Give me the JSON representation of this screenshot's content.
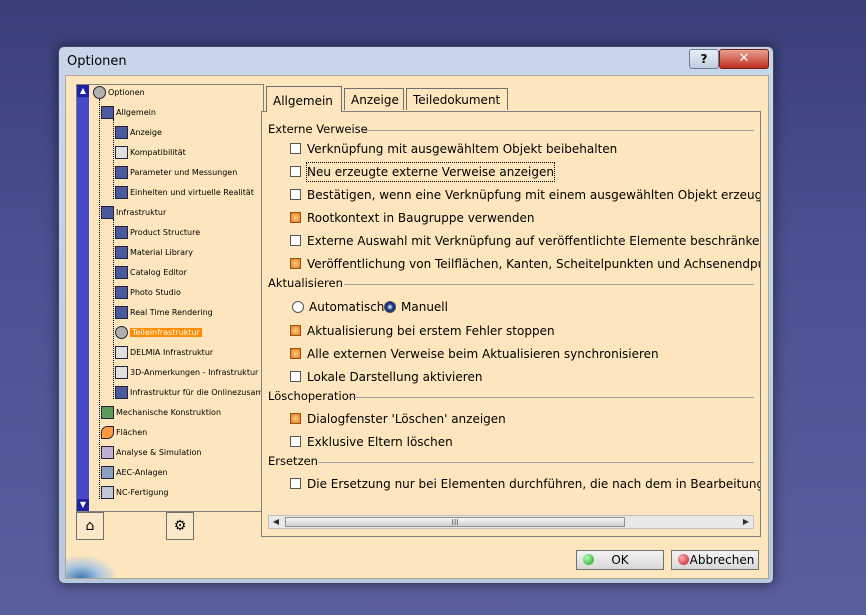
{
  "window": {
    "title": "Optionen",
    "help_label": "?",
    "close_label": "✕"
  },
  "tree": {
    "items": [
      {
        "label": "Optionen"
      },
      {
        "label": "Allgemein"
      },
      {
        "label": "Anzeige"
      },
      {
        "label": "Kompatibilität"
      },
      {
        "label": "Parameter und Messungen"
      },
      {
        "label": "Einheiten und virtuelle Realität"
      },
      {
        "label": "Infrastruktur"
      },
      {
        "label": "Product Structure"
      },
      {
        "label": "Material Library"
      },
      {
        "label": "Catalog Editor"
      },
      {
        "label": "Photo Studio"
      },
      {
        "label": "Real Time Rendering"
      },
      {
        "label": "Teileinfrastruktur"
      },
      {
        "label": "DELMIA Infrastruktur"
      },
      {
        "label": "3D-Anmerkungen - Infrastruktur"
      },
      {
        "label": "Infrastruktur für die Onlinezusamme"
      },
      {
        "label": "Mechanische Konstruktion"
      },
      {
        "label": "Flächen"
      },
      {
        "label": "Analyse & Simulation"
      },
      {
        "label": "AEC-Anlagen"
      },
      {
        "label": "NC-Fertigung"
      }
    ]
  },
  "tabs": [
    {
      "label": "Allgemein"
    },
    {
      "label": "Anzeige"
    },
    {
      "label": "Teiledokument"
    }
  ],
  "groups": {
    "externe": {
      "title": "Externe Verweise",
      "options": [
        {
          "label": "Verknüpfung mit ausgewähltem Objekt beibehalten",
          "checked": false
        },
        {
          "label": "Neu erzeugte externe Verweise anzeigen",
          "checked": false
        },
        {
          "label": "Bestätigen, wenn eine Verknüpfung mit einem ausgewählten Objekt erzeugt wird",
          "checked": false
        },
        {
          "label": "Rootkontext in Baugruppe verwenden",
          "checked": true
        },
        {
          "label": "Externe Auswahl mit Verknüpfung auf veröffentlichte Elemente beschränken",
          "checked": false
        },
        {
          "label": "Veröffentlichung von Teilflächen, Kanten, Scheitelpunkten und Achsenendpunkten z",
          "checked": true
        }
      ]
    },
    "aktualisieren": {
      "title": "Aktualisieren",
      "radio_auto": "Automatisch",
      "radio_manual": "Manuell",
      "options": [
        {
          "label": "Aktualisierung bei erstem Fehler stoppen",
          "checked": true
        },
        {
          "label": "Alle externen Verweise beim Aktualisieren synchronisieren",
          "checked": true
        },
        {
          "label": "Lokale Darstellung aktivieren",
          "checked": false
        }
      ]
    },
    "loesch": {
      "title": "Löschoperation",
      "options": [
        {
          "label": "Dialogfenster 'Löschen' anzeigen",
          "checked": true
        },
        {
          "label": "Exklusive Eltern löschen",
          "checked": false
        }
      ]
    },
    "ersetzen": {
      "title": "Ersetzen",
      "options": [
        {
          "label": "Die Ersetzung nur bei Elementen durchführen, die nach dem in Bearbeitung befindlic",
          "checked": false
        }
      ]
    }
  },
  "buttons": {
    "ok": "OK",
    "cancel": "Abbrechen"
  },
  "scroll_thumb": "III",
  "colors": {
    "checked": "#e07820",
    "selection": "#ff8c00",
    "background": "#fde6bd"
  }
}
